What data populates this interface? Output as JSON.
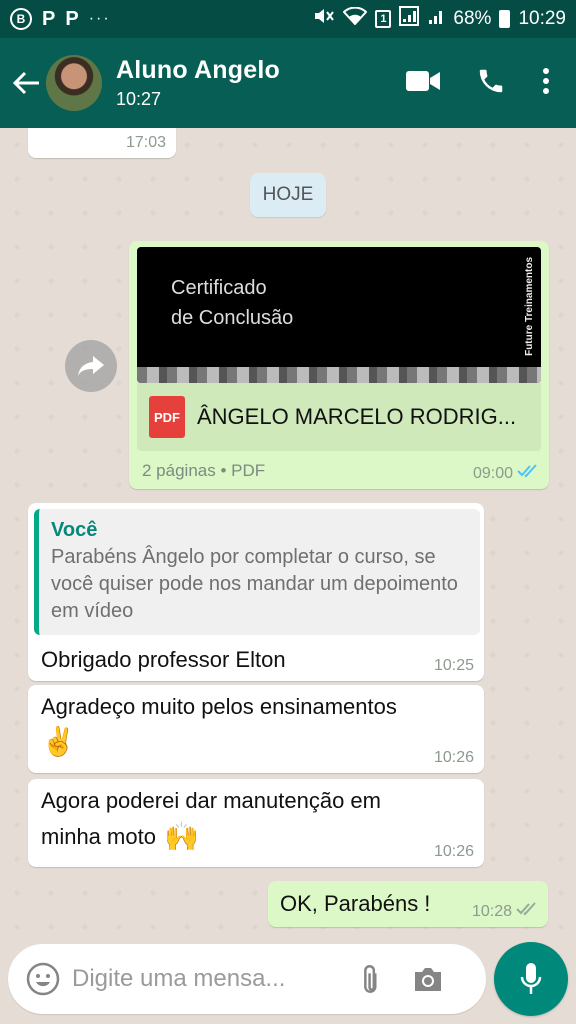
{
  "status_bar": {
    "icon_b": "B",
    "icon_p1": "P",
    "icon_p2": "P",
    "more": "···",
    "sim_slot": "1",
    "battery": "68%",
    "time": "10:29"
  },
  "header": {
    "contact_name": "Aluno Angelo",
    "last_seen": "10:27",
    "icons": [
      "back-arrow-icon",
      "video-call-icon",
      "phone-icon",
      "more-vert-icon"
    ]
  },
  "chat": {
    "partial_message_time": "17:03",
    "date_separator": "HOJE",
    "document": {
      "preview_line1": "Certificado",
      "preview_line2": "de Conclusão",
      "preview_brand": "Future Treinamentos",
      "file_type_badge": "PDF",
      "file_name": "ÂNGELO MARCELO RODRIG...",
      "info": "2 páginas • PDF",
      "time": "09:00"
    },
    "reply": {
      "quoted_author": "Você",
      "quoted_text": "Parabéns Ângelo por completar o curso, se você quiser pode nos mandar um depoimento em vídeo",
      "text": "Obrigado professor Elton",
      "time": "10:25"
    },
    "msg2": {
      "text": "Agradeço muito pelos ensinamentos",
      "emoji": "✌️",
      "time": "10:26"
    },
    "msg3": {
      "line1": "Agora poderei dar manutenção em",
      "line2": "minha moto",
      "emoji": "🙌",
      "time": "10:26"
    },
    "msg4": {
      "text": "OK, Parabéns !",
      "time": "10:28"
    }
  },
  "composer": {
    "placeholder": "Digite uma mensa..."
  },
  "colors": {
    "status_bar": "#054d44",
    "app_bar": "#075e54",
    "outgoing_bubble": "#dcf8c6",
    "incoming_bubble": "#ffffff",
    "accent": "#00897b",
    "read_ticks": "#4fc3f7"
  }
}
